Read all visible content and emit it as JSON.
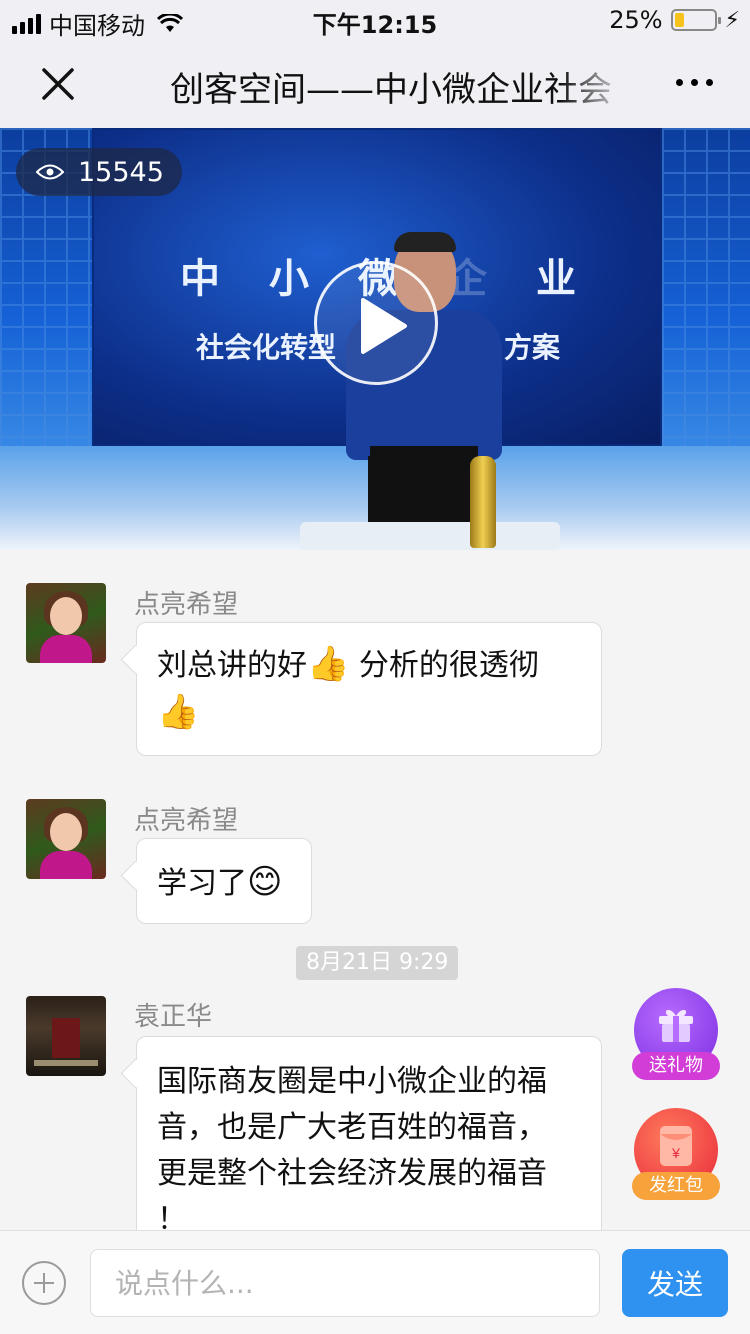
{
  "status_bar": {
    "carrier": "中国移动",
    "time": "下午12:15",
    "battery_percent": "25%",
    "battery_level": 0.25
  },
  "nav": {
    "title": "创客空间——中小微企业社会",
    "close_icon": "close-icon",
    "more_icon": "more-icon"
  },
  "video": {
    "viewer_count": "15545",
    "banner_line1": [
      "中",
      "小",
      "微",
      "企",
      "业"
    ],
    "banner_line2_left": "社会化转型",
    "banner_line2_right": "方案"
  },
  "messages": [
    {
      "sender": "点亮希望",
      "text_line1": "刘总讲的好",
      "emoji1": "👍",
      "text_line1b": " 分析的很透彻",
      "emoji2": "👍"
    },
    {
      "sender": "点亮希望",
      "text": "学习了",
      "emoji": "😊"
    },
    {
      "timestamp": "8月21日 9:29"
    },
    {
      "sender": "袁正华",
      "text_lines": [
        "国际商友圈是中小微企业的福",
        "音，也是广大老百姓的福音，",
        "更是整个社会经济发展的福音",
        "！"
      ]
    }
  ],
  "fabs": {
    "gift_label": "送礼物",
    "red_packet_label": "发红包",
    "red_packet_symbol": "¥"
  },
  "input": {
    "placeholder": "说点什么...",
    "send_label": "发送"
  }
}
